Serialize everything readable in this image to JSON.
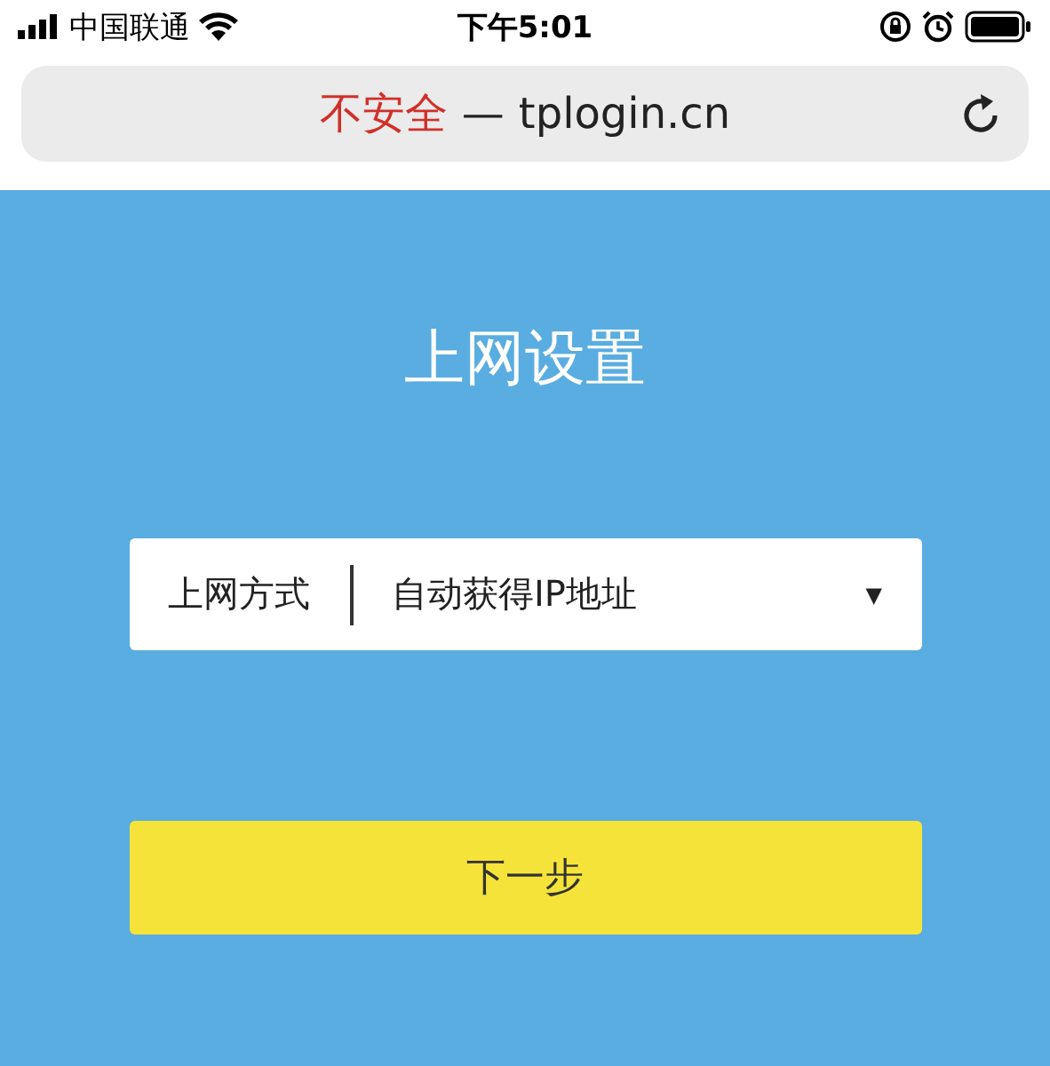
{
  "status_bar": {
    "carrier": "中国联通",
    "time": "下午5:01"
  },
  "address_bar": {
    "security": "不安全",
    "separator": "—",
    "url": "tplogin.cn"
  },
  "page": {
    "title": "上网设置",
    "field": {
      "label": "上网方式",
      "value": "自动获得IP地址",
      "arrow": "▼"
    },
    "button": "下一步"
  }
}
